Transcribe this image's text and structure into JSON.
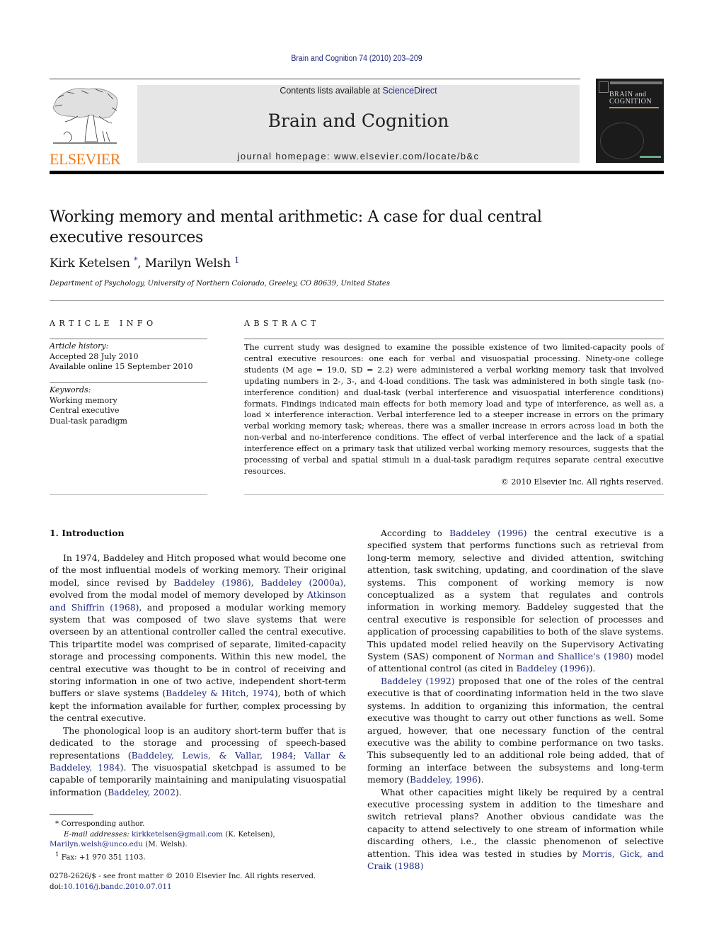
{
  "header": {
    "citation": "Brain and Cognition 74 (2010) 203–209",
    "contents_prefix": "Contents lists available at ",
    "contents_link": "ScienceDirect",
    "journal_title": "Brain and Cognition",
    "homepage": "journal homepage: www.elsevier.com/locate/b&c",
    "publisher_logo_text": "ELSEVIER",
    "cover": {
      "line1": "BRAIN and",
      "line2": "COGNITION"
    },
    "colors": {
      "link": "#1f2a80",
      "elsevier_orange": "#f07a18",
      "masthead_bg": "#e6e6e6"
    }
  },
  "article": {
    "title": "Working memory and mental arithmetic: A case for dual central executive resources",
    "authors": [
      {
        "name": "Kirk Ketelsen",
        "mark": "*"
      },
      {
        "name": "Marilyn Welsh",
        "mark": "1"
      }
    ],
    "author_separator": ", ",
    "affiliation": "Department of Psychology, University of Northern Colorado, Greeley, CO 80639, United States"
  },
  "article_info": {
    "heading": "ARTICLE INFO",
    "history_label": "Article history:",
    "history": [
      "Accepted 28 July 2010",
      "Available online 15 September 2010"
    ],
    "keywords_label": "Keywords:",
    "keywords": [
      "Working memory",
      "Central executive",
      "Dual-task paradigm"
    ]
  },
  "abstract": {
    "heading": "ABSTRACT",
    "text": "The current study was designed to examine the possible existence of two limited-capacity pools of central executive resources: one each for verbal and visuospatial processing. Ninety-one college students (M age = 19.0, SD = 2.2) were administered a verbal working memory task that involved updating numbers in 2-, 3-, and 4-load conditions. The task was administered in both single task (no-interference condition) and dual-task (verbal interference and visuospatial interference conditions) formats. Findings indicated main effects for both memory load and type of interference, as well as, a load × interference interaction. Verbal interference led to a steeper increase in errors on the primary verbal working memory task; whereas, there was a smaller increase in errors across load in both the non-verbal and no-interference conditions. The effect of verbal interference and the lack of a spatial interference effect on a primary task that utilized verbal working memory resources, suggests that the processing of verbal and spatial stimuli in a dual-task paradigm requires separate central executive resources.",
    "copyright": "© 2010 Elsevier Inc. All rights reserved."
  },
  "body": {
    "section_heading": "1. Introduction",
    "left_paragraphs": [
      [
        {
          "t": "In 1974, Baddeley and Hitch proposed what would become one of the most influential models of working memory. Their original model, since revised by "
        },
        {
          "l": "Baddeley (1986)"
        },
        {
          "t": ", "
        },
        {
          "l": "Baddeley (2000a)"
        },
        {
          "t": ", evolved from the modal model of memory developed by "
        },
        {
          "l": "Atkinson and Shiffrin (1968)"
        },
        {
          "t": ", and proposed a modular working memory system that was composed of two slave systems that were overseen by an attentional controller called the central executive. This tripartite model was comprised of separate, limited-capacity storage and processing components. Within this new model, the central executive was thought to be in control of receiving and storing information in one of two active, independent short-term buffers or slave systems ("
        },
        {
          "l": "Baddeley & Hitch, 1974"
        },
        {
          "t": "), both of which kept the information available for further, complex processing by the central executive."
        }
      ],
      [
        {
          "t": "The phonological loop is an auditory short-term buffer that is dedicated to the storage and processing of speech-based representations ("
        },
        {
          "l": "Baddeley, Lewis, & Vallar, 1984"
        },
        {
          "t": "; "
        },
        {
          "l": "Vallar & Baddeley, 1984"
        },
        {
          "t": "). The visuospatial sketchpad is assumed to be capable of temporarily maintaining and manipulating visuospatial information ("
        },
        {
          "l": "Baddeley, 2002"
        },
        {
          "t": ")."
        }
      ]
    ],
    "right_paragraphs": [
      [
        {
          "t": "According to "
        },
        {
          "l": "Baddeley (1996)"
        },
        {
          "t": " the central executive is a specified system that performs functions such as retrieval from long-term memory, selective and divided attention, switching attention, task switching, updating, and coordination of the slave systems. This component of working memory is now conceptualized as a system that regulates and controls information in working memory. Baddeley suggested that the central executive is responsible for selection of processes and application of processing capabilities to both of the slave systems. This updated model relied heavily on the Supervisory Activating System (SAS) component of "
        },
        {
          "l": "Norman and Shallice's (1980)"
        },
        {
          "t": " model of attentional control (as cited in "
        },
        {
          "l": "Baddeley (1996)"
        },
        {
          "t": ")."
        }
      ],
      [
        {
          "l": "Baddeley (1992)"
        },
        {
          "t": " proposed that one of the roles of the central executive is that of coordinating information held in the two slave systems. In addition to organizing this information, the central executive was thought to carry out other functions as well. Some argued, however, that one necessary function of the central executive was the ability to combine performance on two tasks. This subsequently led to an additional role being added, that of forming an interface between the subsystems and long-term memory ("
        },
        {
          "l": "Baddeley, 1996"
        },
        {
          "t": ")."
        }
      ],
      [
        {
          "t": "What other capacities might likely be required by a central executive processing system in addition to the timeshare and switch retrieval plans? Another obvious candidate was the capacity to attend selectively to one stream of information while discarding others, i.e., the classic phenomenon of selective attention. This idea was tested in studies by "
        },
        {
          "l": "Morris, Gick, and Craik (1988)"
        }
      ]
    ]
  },
  "footnotes": {
    "corresponding": "Corresponding author.",
    "corresponding_mark": "*",
    "email_label": "E-mail addresses:",
    "email1": "kirkketelsen@gmail.com",
    "email1_owner": " (K. Ketelsen), ",
    "email2": "Marilyn.welsh@unco.edu",
    "email2_owner": " (M. Welsh).",
    "fax_mark": "1",
    "fax": "Fax: +1 970 351 1103."
  },
  "front_matter": {
    "issn_line": "0278-2626/$ - see front matter © 2010 Elsevier Inc. All rights reserved.",
    "doi_prefix": "doi:",
    "doi": "10.1016/j.bandc.2010.07.011"
  }
}
